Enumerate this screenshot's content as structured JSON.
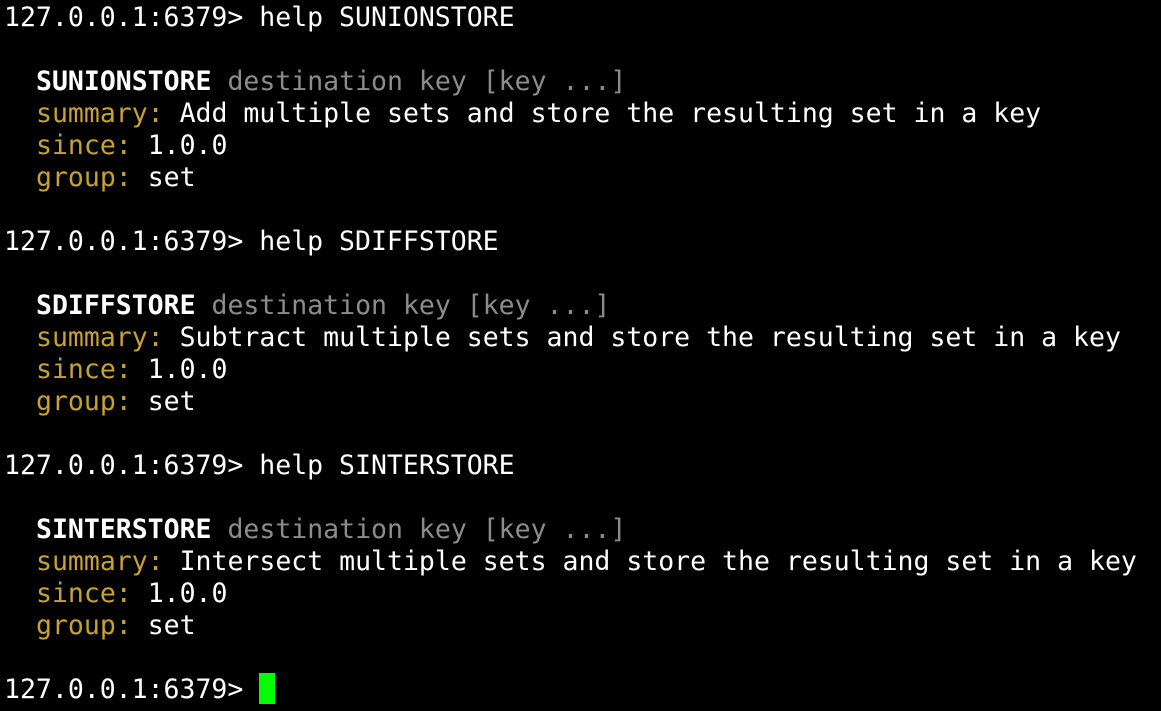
{
  "terminal": {
    "prompt": "127.0.0.1:6379> ",
    "entries": [
      {
        "command": "help SUNIONSTORE",
        "name": "SUNIONSTORE",
        "args": " destination key [key ...]",
        "summary_label": "summary:",
        "summary": " Add multiple sets and store the resulting set in a key",
        "since_label": "since:",
        "since": " 1.0.0",
        "group_label": "group:",
        "group": " set"
      },
      {
        "command": "help SDIFFSTORE",
        "name": "SDIFFSTORE",
        "args": " destination key [key ...]",
        "summary_label": "summary:",
        "summary": " Subtract multiple sets and store the resulting set in a key",
        "since_label": "since:",
        "since": " 1.0.0",
        "group_label": "group:",
        "group": " set"
      },
      {
        "command": "help SINTERSTORE",
        "name": "SINTERSTORE",
        "args": " destination key [key ...]",
        "summary_label": "summary:",
        "summary": " Intersect multiple sets and store the resulting set in a key",
        "since_label": "since:",
        "since": " 1.0.0",
        "group_label": "group:",
        "group": " set"
      }
    ],
    "final_input": "",
    "colors": {
      "background": "#000000",
      "text": "#ffffff",
      "args": "#8c8c8c",
      "label": "#c8a22c",
      "cursor": "#00ff00"
    }
  }
}
